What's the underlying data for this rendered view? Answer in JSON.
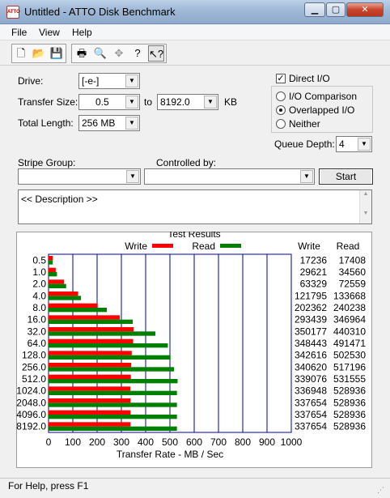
{
  "window": {
    "title": "Untitled - ATTO Disk Benchmark",
    "icon_text": "ATTO"
  },
  "menu": [
    "File",
    "View",
    "Help"
  ],
  "toolbar": [
    "new-icon",
    "open-icon",
    "save-icon",
    "print-icon",
    "print-preview-icon",
    "move-icon",
    "help-icon",
    "context-help-icon"
  ],
  "form": {
    "drive_label": "Drive:",
    "drive_value": "[-e-]",
    "transfer_size_label": "Transfer Size:",
    "transfer_from": "0.5",
    "to_label": "to",
    "transfer_to": "8192.0",
    "kb_label": "KB",
    "total_length_label": "Total Length:",
    "total_length_value": "256 MB",
    "direct_io_label": "Direct I/O",
    "direct_io_checked": true,
    "io_options": [
      "I/O Comparison",
      "Overlapped I/O",
      "Neither"
    ],
    "io_selected": 1,
    "queue_depth_label": "Queue Depth:",
    "queue_depth_value": "4",
    "stripe_group_label": "Stripe Group:",
    "controlled_by_label": "Controlled by:",
    "start_label": "Start",
    "description_text": "<< Description >>"
  },
  "chart_data": {
    "type": "bar",
    "title": "Test Results",
    "xlabel": "Transfer Rate - MB / Sec",
    "xlim": [
      0,
      1000
    ],
    "x_ticks": [
      "0",
      "100",
      "200",
      "300",
      "400",
      "500",
      "600",
      "700",
      "800",
      "900",
      "1000"
    ],
    "categories": [
      "0.5",
      "1.0",
      "2.0",
      "4.0",
      "8.0",
      "16.0",
      "32.0",
      "64.0",
      "128.0",
      "256.0",
      "512.0",
      "1024.0",
      "2048.0",
      "4096.0",
      "8192.0"
    ],
    "series": [
      {
        "name": "Write",
        "color": "#ff0000",
        "values": [
          17.2,
          29.6,
          63.3,
          121.8,
          202.4,
          293.4,
          350.2,
          348.4,
          342.6,
          340.6,
          339.1,
          336.9,
          337.7,
          337.7,
          337.7
        ]
      },
      {
        "name": "Read",
        "color": "#008000",
        "values": [
          17.4,
          34.6,
          72.6,
          133.7,
          240.2,
          347.0,
          440.3,
          491.5,
          502.5,
          517.2,
          531.6,
          528.9,
          528.9,
          528.9,
          528.9
        ]
      }
    ],
    "table_headers": [
      "Write",
      "Read"
    ],
    "table": [
      [
        "17236",
        "17408"
      ],
      [
        "29621",
        "34560"
      ],
      [
        "63329",
        "72559"
      ],
      [
        "121795",
        "133668"
      ],
      [
        "202362",
        "240238"
      ],
      [
        "293439",
        "346964"
      ],
      [
        "350177",
        "440310"
      ],
      [
        "348443",
        "491471"
      ],
      [
        "342616",
        "502530"
      ],
      [
        "340620",
        "517196"
      ],
      [
        "339076",
        "531555"
      ],
      [
        "336948",
        "528936"
      ],
      [
        "337654",
        "528936"
      ],
      [
        "337654",
        "528936"
      ],
      [
        "337654",
        "528936"
      ]
    ],
    "grid_color": "#0000a0"
  },
  "status": {
    "text": "For Help, press F1"
  }
}
